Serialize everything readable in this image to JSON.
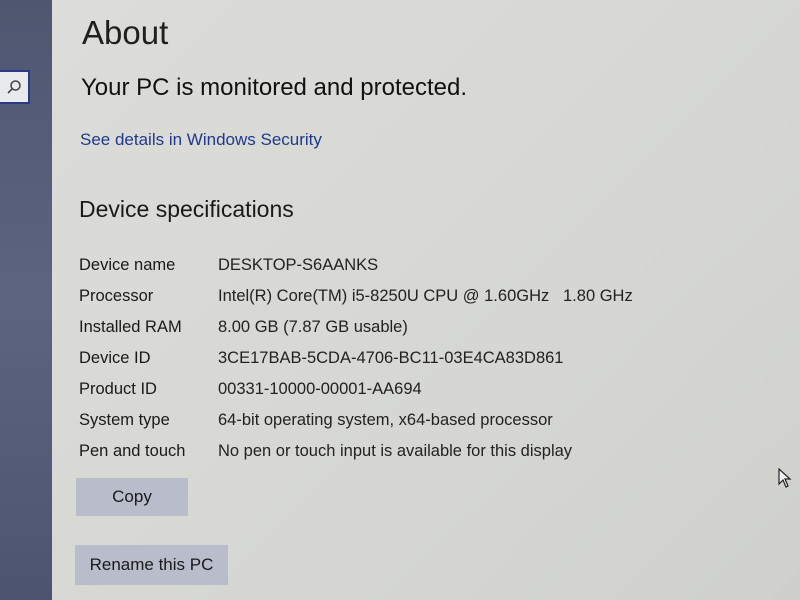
{
  "sidebar": {
    "search_icon": "search-icon"
  },
  "page": {
    "title": "About",
    "security_status": "Your PC is monitored and protected.",
    "security_link": "See details in Windows Security"
  },
  "device_specifications": {
    "heading": "Device specifications",
    "rows": [
      {
        "label": "Device name",
        "value": "DESKTOP-S6AANKS"
      },
      {
        "label": "Processor",
        "value": "Intel(R) Core(TM) i5-8250U CPU @ 1.60GHz   1.80 GHz"
      },
      {
        "label": "Installed RAM",
        "value": "8.00 GB (7.87 GB usable)"
      },
      {
        "label": "Device ID",
        "value": "3CE17BAB-5CDA-4706-BC11-03E4CA83D861"
      },
      {
        "label": "Product ID",
        "value": "00331-10000-00001-AA694"
      },
      {
        "label": "System type",
        "value": "64-bit operating system, x64-based processor"
      },
      {
        "label": "Pen and touch",
        "value": "No pen or touch input is available for this display"
      }
    ]
  },
  "buttons": {
    "copy": "Copy",
    "rename": "Rename this PC"
  },
  "colors": {
    "link": "#1f3a8a",
    "button_bg": "#b9bccb",
    "sidebar_bg": "#545c78"
  }
}
